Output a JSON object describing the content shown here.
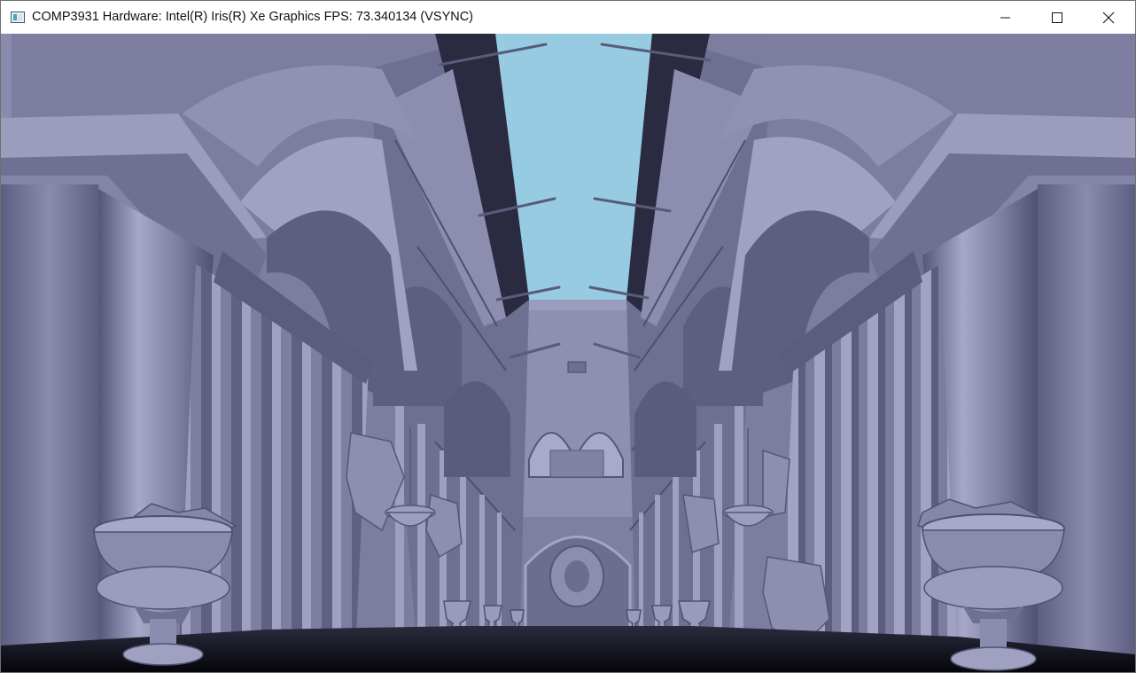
{
  "window": {
    "title": "COMP3931 Hardware: Intel(R) Iris(R) Xe Graphics FPS: 73.340134 (VSYNC)",
    "icon": "application-window-icon",
    "controls": [
      "minimize-icon",
      "maximize-icon",
      "close-icon"
    ]
  },
  "viewport": {
    "scene": "3d-atrium-render",
    "colors": {
      "sky": "#96cbe2",
      "geometry": "#7c7d9f",
      "geometry_light": "#a3a4c4",
      "geometry_dark": "#4a4b69",
      "shadow": "#0b0b14"
    }
  }
}
